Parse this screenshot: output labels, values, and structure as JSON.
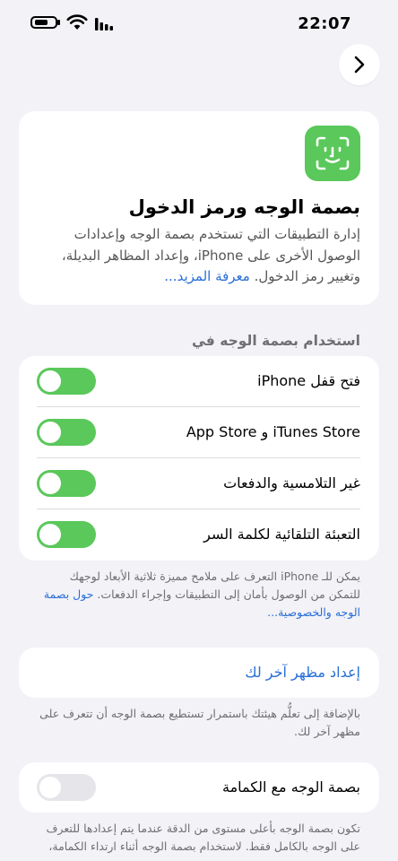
{
  "status_bar": {
    "time": "22:07"
  },
  "hero": {
    "title": "بصمة الوجه ورمز الدخول",
    "description": "إدارة التطبيقات التي تستخدم بصمة الوجه وإعدادات الوصول الأخرى على iPhone، وإعداد المظاهر البديلة، وتغيير رمز الدخول.",
    "learn_more": "معرفة المزيد..."
  },
  "use_face_id": {
    "header": "استخدام بصمة الوجه في",
    "rows": [
      {
        "label": "فتح قفل iPhone",
        "on": true
      },
      {
        "label": "iTunes Store و App Store",
        "on": true
      },
      {
        "label": "غير التلامسية والدفعات",
        "on": true
      },
      {
        "label": "التعبئة التلقائية لكلمة السر",
        "on": true
      }
    ],
    "footnote": "يمكن للـ iPhone التعرف على ملامح مميزة ثلاثية الأبعاد لوجهك للتمكن من الوصول بأمان إلى التطبيقات وإجراء الدفعات.",
    "footnote_link": "حول بصمة الوجه والخصوصية..."
  },
  "alternate": {
    "label": "إعداد مظهر آخر لك",
    "footnote": "بالإضافة إلى تعلُّم هيئتك باستمرار تستطيع بصمة الوجه أن تتعرف على مظهر آخر لك."
  },
  "mask": {
    "label": "بصمة الوجه مع الكمامة",
    "on": false,
    "footnote": "تكون بصمة الوجه بأعلى مستوى من الدقة عندما يتم إعدادها للتعرف على الوجه بالكامل فقط. لاستخدام بصمة الوجه أثناء ارتداء الكمامة،"
  },
  "colors": {
    "accent": "#2a6fd6",
    "toggle_on": "#5ac85a",
    "background": "#f2f2f7"
  }
}
